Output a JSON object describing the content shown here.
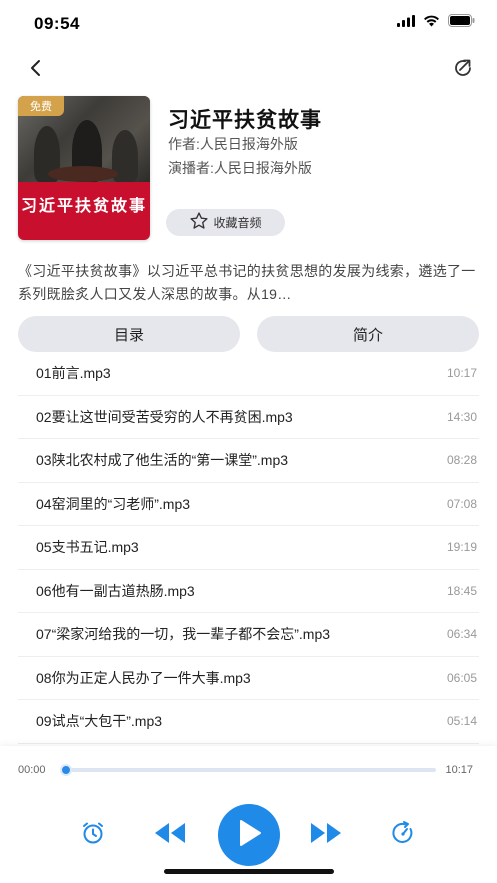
{
  "status": {
    "time": "09:54"
  },
  "book": {
    "badge": "免费",
    "cover_title": "习近平扶贫故事",
    "title": "习近平扶贫故事",
    "author": "作者:人民日报海外版",
    "narrator": "演播者:人民日报海外版",
    "favorite_label": "收藏音频",
    "description": "《习近平扶贫故事》以习近平总书记的扶贫思想的发展为线索，遴选了一系列既脍炙人口又发人深思的故事。从19…"
  },
  "tabs": [
    {
      "label": "目录"
    },
    {
      "label": "简介"
    }
  ],
  "tracks": [
    {
      "name": "01前言.mp3",
      "duration": "10:17"
    },
    {
      "name": "02要让这世间受苦受穷的人不再贫困.mp3",
      "duration": "14:30"
    },
    {
      "name": "03陕北农村成了他生活的“第一课堂”.mp3",
      "duration": "08:28"
    },
    {
      "name": "04窑洞里的“习老师”.mp3",
      "duration": "07:08"
    },
    {
      "name": "05支书五记.mp3",
      "duration": "19:19"
    },
    {
      "name": "06他有一副古道热肠.mp3",
      "duration": "18:45"
    },
    {
      "name": "07“梁家河给我的一切，我一辈子都不会忘”.mp3",
      "duration": "06:34"
    },
    {
      "name": "08你为正定人民办了一件大事.mp3",
      "duration": "06:05"
    },
    {
      "name": "09试点“大包干”.mp3",
      "duration": "05:14"
    }
  ],
  "player": {
    "current_time": "00:00",
    "total_time": "10:17",
    "progress": 0.0
  },
  "icons": {
    "back": "chevron-left-icon",
    "share": "share-icon",
    "favorite": "star-outline-icon",
    "timer": "alarm-clock-icon",
    "prev": "rewind-icon",
    "play": "play-icon",
    "next": "fast-forward-icon",
    "speed": "speed-icon"
  },
  "colors": {
    "accent": "#1f8ae8",
    "cover_red": "#c8102e",
    "badge_gold": "#d4a24a"
  }
}
